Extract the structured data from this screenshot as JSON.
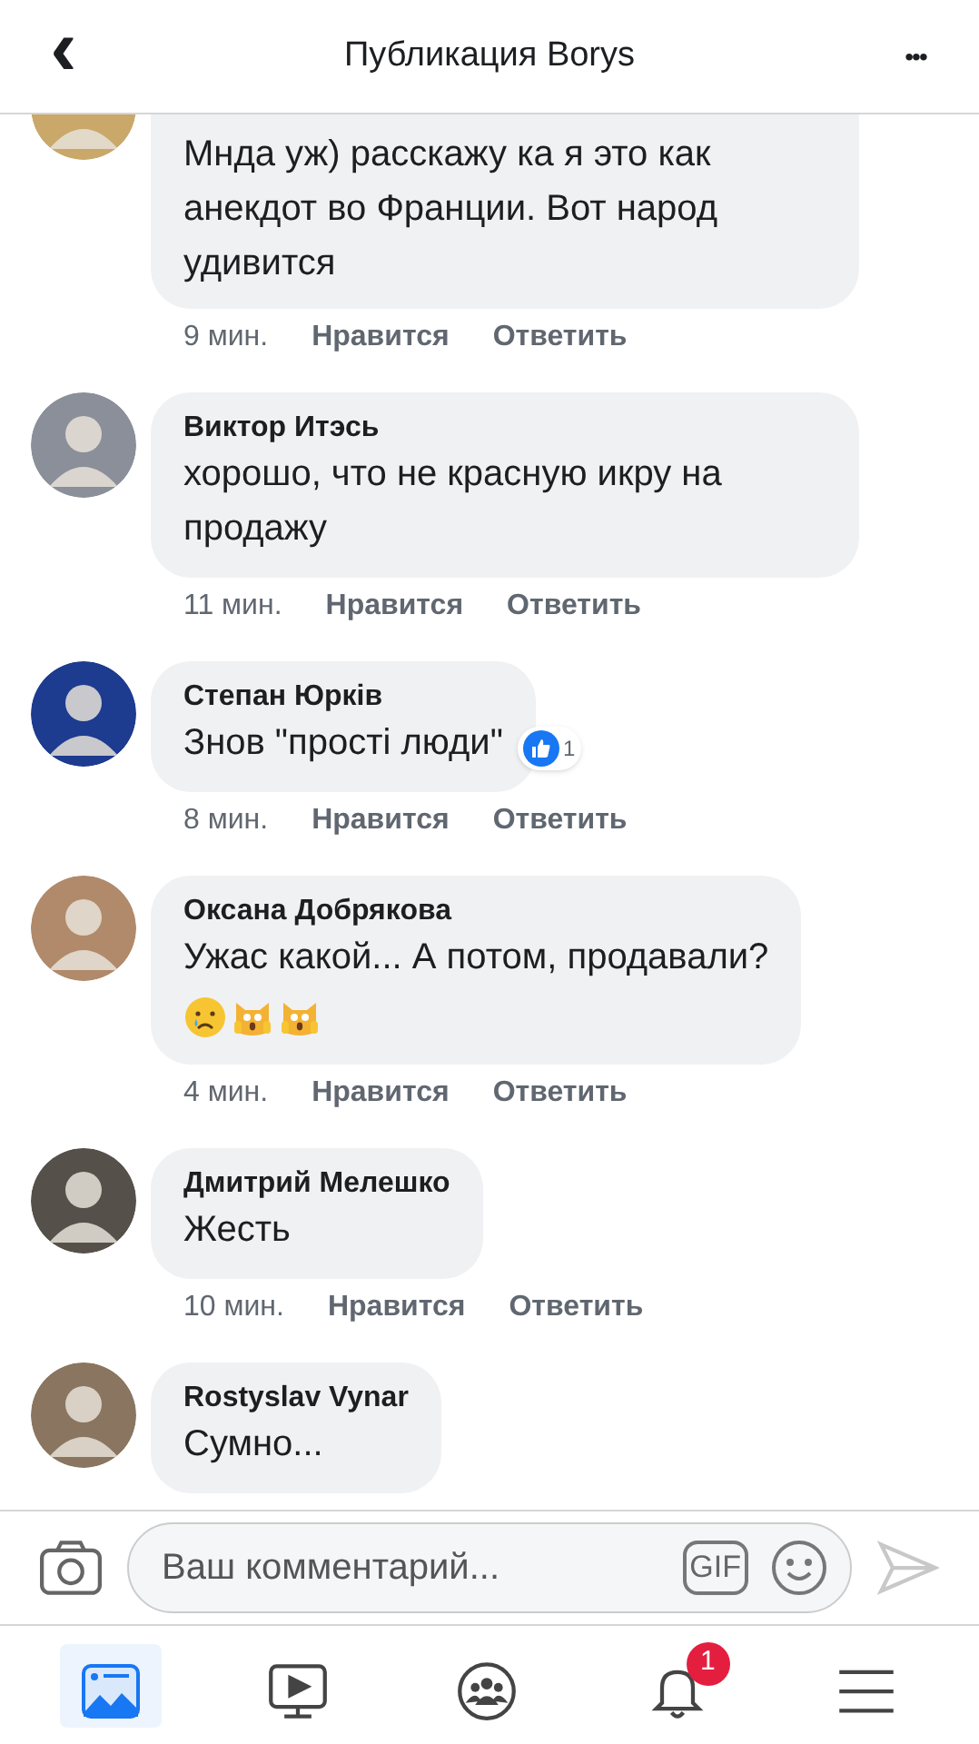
{
  "header": {
    "back": "‹",
    "title": "Публикация Borys",
    "more": "•••"
  },
  "comments": [
    {
      "text": "Мнда уж) расскажу ка я это как анекдот во Франции.  Вот народ удивится",
      "time": "9 мин.",
      "like": "Нравится",
      "reply": "Ответить"
    },
    {
      "author": "Виктор Итэсь",
      "text": "хорошо, что не красную икру на продажу",
      "time": "11 мин.",
      "like": "Нравится",
      "reply": "Ответить"
    },
    {
      "author": "Степан Юрків",
      "text": "Знов \"прості люди\"",
      "likes": "1",
      "time": "8 мин.",
      "like": "Нравится",
      "reply": "Ответить"
    },
    {
      "author": "Оксана Добрякова",
      "text": "Ужас какой... А потом, продавали?",
      "emoji": [
        {
          "kind": "crying"
        },
        {
          "kind": "scream_cat"
        },
        {
          "kind": "scream_cat"
        }
      ],
      "time": "4 мин.",
      "like": "Нравится",
      "reply": "Ответить"
    },
    {
      "author": "Дмитрий Мелешко",
      "text": "Жесть",
      "time": "10 мин.",
      "like": "Нравится",
      "reply": "Ответить"
    },
    {
      "author": "Rostyslav Vynar",
      "text": "Сумно..."
    }
  ],
  "composer": {
    "placeholder": "Ваш комментарий...",
    "gif": "GIF"
  },
  "tabs": [
    {
      "kind": "feed",
      "selected": true
    },
    {
      "kind": "video",
      "selected": false
    },
    {
      "kind": "groups",
      "selected": false
    },
    {
      "kind": "notifications",
      "selected": false,
      "badge": "1"
    },
    {
      "kind": "menu",
      "selected": false
    }
  ]
}
